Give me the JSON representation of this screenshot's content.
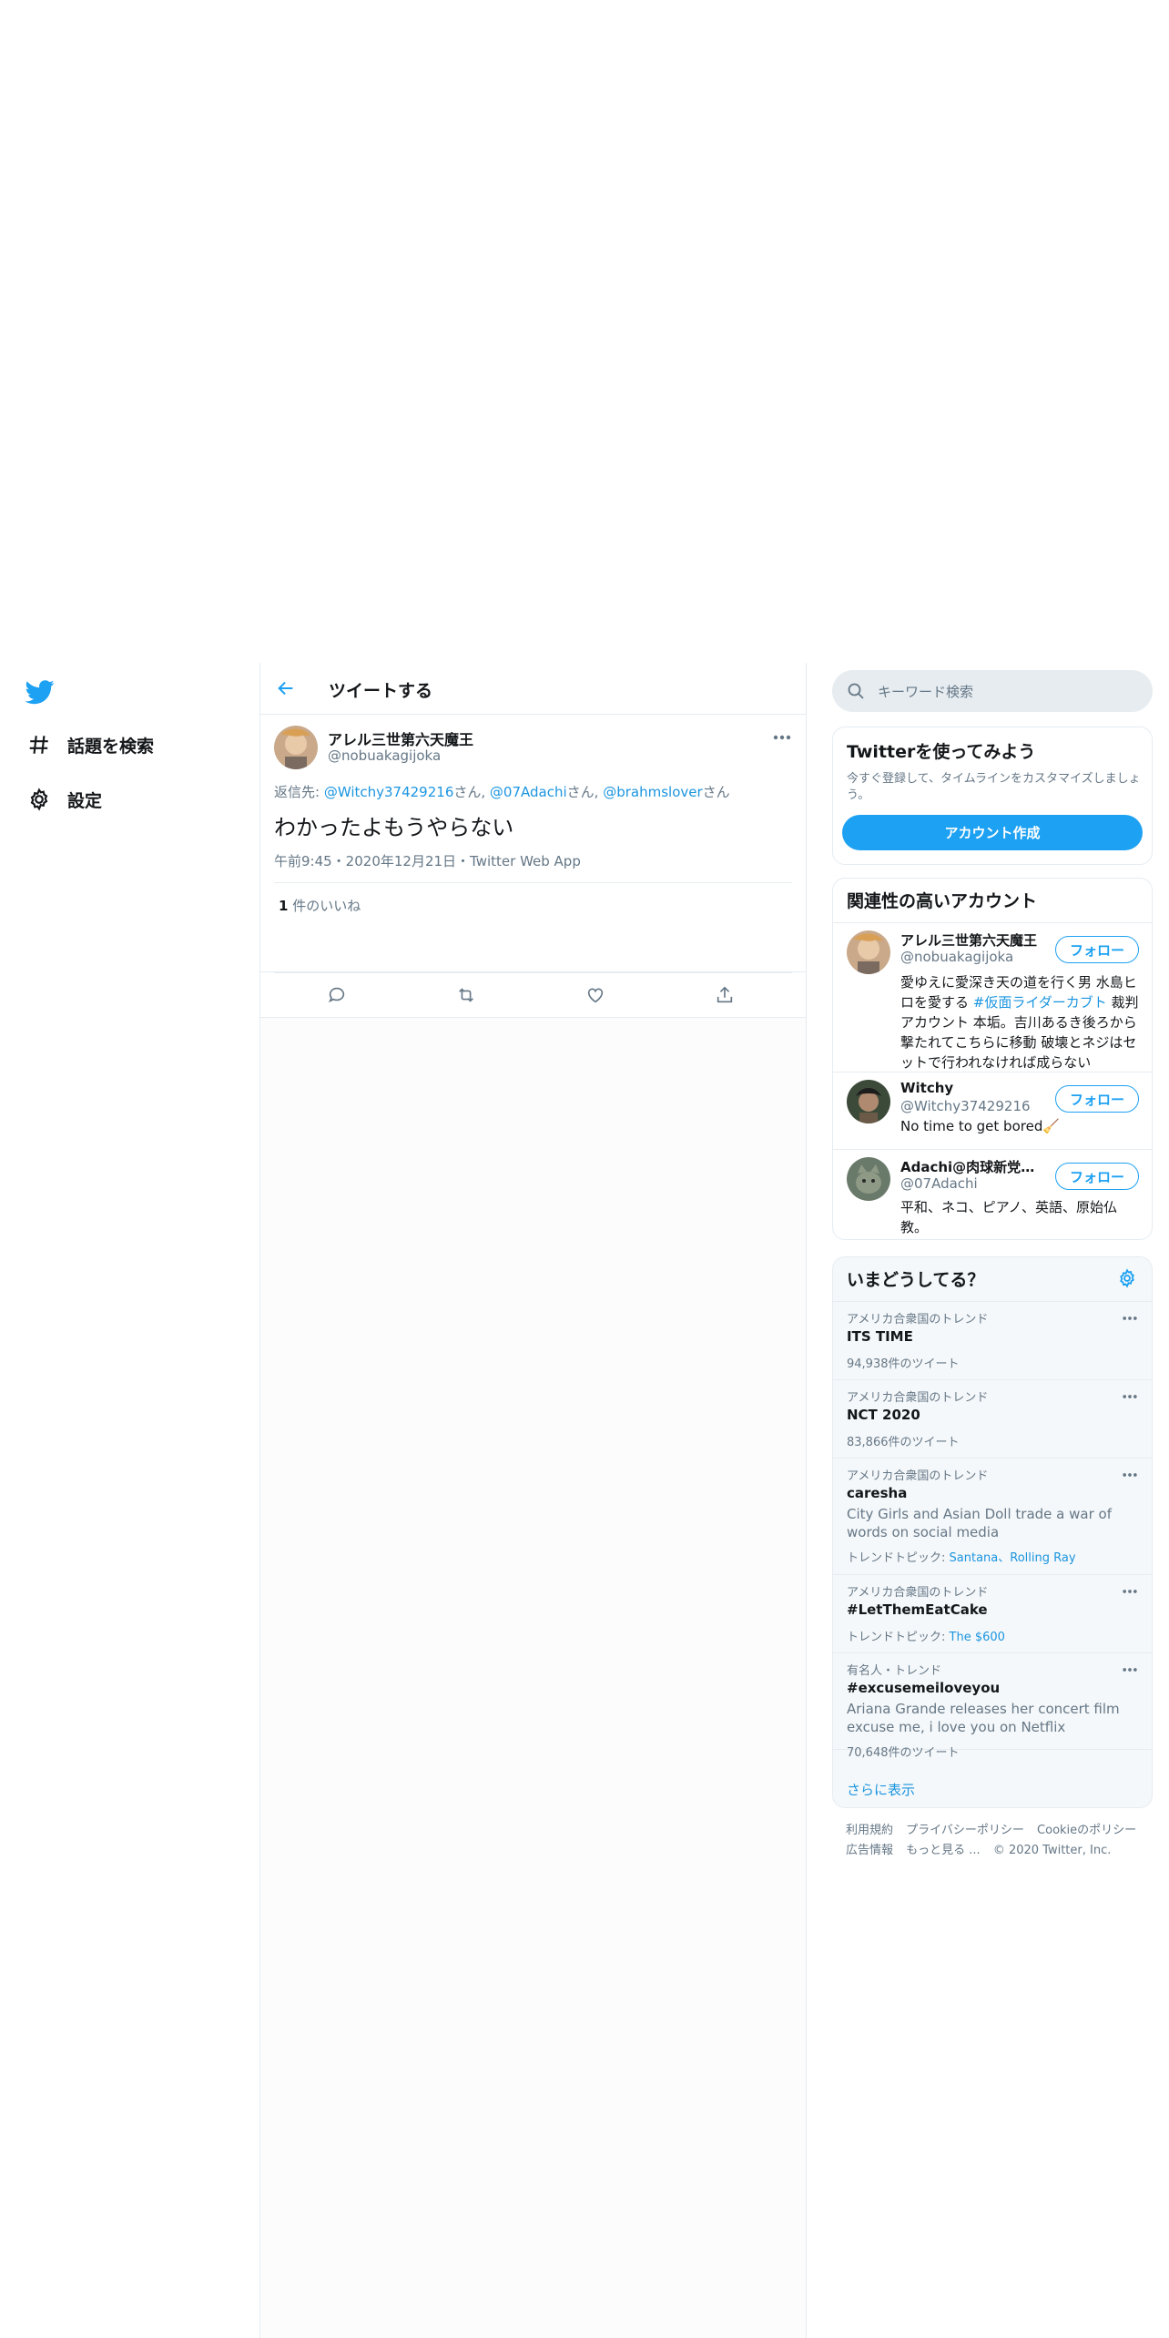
{
  "nav": {
    "items": [
      {
        "label": "話題を検索",
        "icon": "hashtag-icon"
      },
      {
        "label": "設定",
        "icon": "gear-icon"
      }
    ]
  },
  "header": {
    "title": "ツイートする"
  },
  "tweet": {
    "author_name": "アレル三世第六天魔王",
    "author_handle": "@nobuakagijoka",
    "reply_prefix": "返信先: ",
    "reply_to": [
      "@Witchy37429216",
      "@07Adachi",
      "@brahmslover"
    ],
    "reply_suffix": "さん",
    "reply_sep": ", ",
    "text": "わかったよもうやらない",
    "meta": "午前9:45・2020年12月21日・Twitter Web App",
    "like_count": "1",
    "like_label": " 件のいいね"
  },
  "search": {
    "placeholder": "キーワード検索"
  },
  "signup": {
    "title": "Twitterを使ってみよう",
    "desc": "今すぐ登録して、タイムラインをカスタマイズしましょう。",
    "button": "アカウント作成"
  },
  "who_to_follow": {
    "title": "関連性の高いアカウント",
    "follow_label": "フォロー",
    "users": [
      {
        "name": "アレル三世第六天魔王",
        "handle": "@nobuakagijoka",
        "bio_pre": "愛ゆえに愛深き天の道を行く男 水島ヒロを愛する ",
        "bio_link": "#仮面ライダーカブト",
        "bio_post": " 裁判アカウント 本垢。吉川あるき後ろから撃たれてこちらに移動 破壊とネジはセットで行われなければ成らない"
      },
      {
        "name": "Witchy",
        "handle": "@Witchy37429216",
        "bio_pre": "No time to get bored🧹",
        "bio_link": "",
        "bio_post": ""
      },
      {
        "name": "Adachi@肉球新党&A...",
        "handle": "@07Adachi",
        "bio_pre": "平和、ネコ、ピアノ、英語、原始仏教。",
        "bio_link": "",
        "bio_post": ""
      }
    ]
  },
  "trends": {
    "title": "いまどうしてる？",
    "items": [
      {
        "context": "アメリカ合衆国のトレンド",
        "name": "ITS TIME",
        "desc": "",
        "topics_label": "",
        "topics": "",
        "count": "94,938件のツイート"
      },
      {
        "context": "アメリカ合衆国のトレンド",
        "name": "NCT 2020",
        "desc": "",
        "topics_label": "",
        "topics": "",
        "count": "83,866件のツイート"
      },
      {
        "context": "アメリカ合衆国のトレンド",
        "name": "caresha",
        "desc": "City Girls and Asian Doll trade a war of words on social media",
        "topics_label": "トレンドトピック: ",
        "topics": "Santana、Rolling Ray",
        "count": ""
      },
      {
        "context": "アメリカ合衆国のトレンド",
        "name": "#LetThemEatCake",
        "desc": "",
        "topics_label": "トレンドトピック: ",
        "topics": "The $600",
        "count": ""
      },
      {
        "context": "有名人・トレンド",
        "name": "#excusemeiloveyou",
        "desc": "Ariana Grande releases her concert film excuse me, i love you on Netflix",
        "topics_label": "",
        "topics": "",
        "count": "70,648件のツイート"
      }
    ],
    "show_more": "さらに表示"
  },
  "footer": {
    "links": [
      "利用規約",
      "プライバシーポリシー",
      "Cookieのポリシー",
      "広告情報",
      "もっと見る ..."
    ],
    "copyright": "© 2020 Twitter, Inc."
  },
  "colors": {
    "accent": "#1da1f2",
    "link": "#1b95e0",
    "muted": "#657786",
    "border": "#e6ecf0"
  }
}
